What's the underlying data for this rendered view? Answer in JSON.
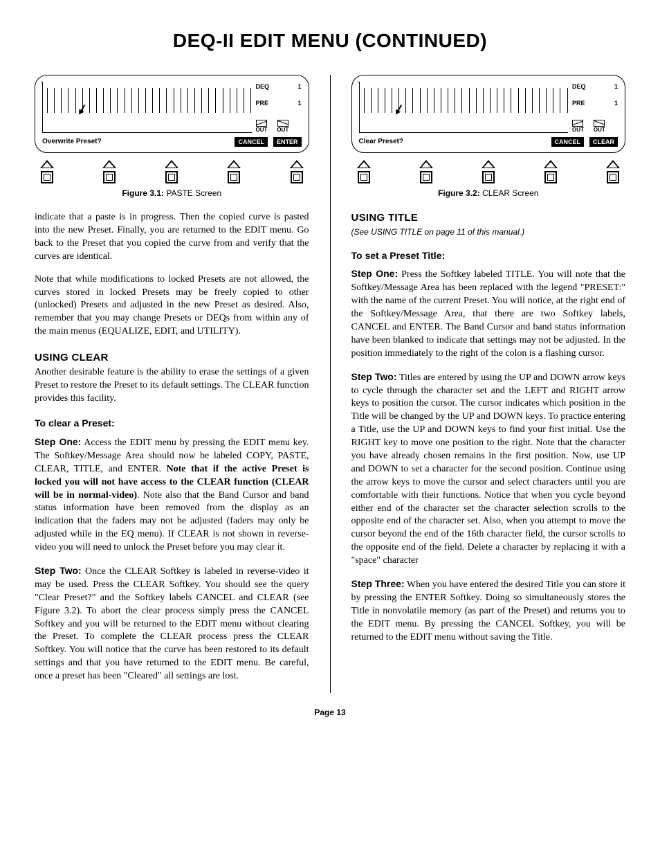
{
  "pageTitle": "DEQ-II EDIT MENU (CONTINUED)",
  "pageNumber": "Page 13",
  "figures": {
    "f1": {
      "question": "Overwrite Preset?",
      "btn1": "CANCEL",
      "btn2": "ENTER",
      "deq": "DEQ",
      "deqv": "1",
      "pre": "PRE",
      "prev": "1",
      "out": "OUT",
      "captionBold": "Figure 3.1:",
      "captionRest": " PASTE Screen"
    },
    "f2": {
      "question": "Clear Preset?",
      "btn1": "CANCEL",
      "btn2": "CLEAR",
      "deq": "DEQ",
      "deqv": "1",
      "pre": "PRE",
      "prev": "1",
      "out": "OUT",
      "captionBold": "Figure 3.2:",
      "captionRest": " CLEAR Screen"
    }
  },
  "left": {
    "p1": "indicate that a paste is in progress. Then the copied curve is pasted into the new Preset. Finally, you are returned to the EDIT menu. Go back to the Preset that you copied the curve from and verify that the curves are identical.",
    "p2": "Note that while modifications to locked Presets are not allowed, the curves stored in locked Presets may be freely copied to other (unlocked) Presets and adjusted in the new Preset as desired. Also, remember that you may change Presets or DEQs from within any of the main menus (EQUALIZE, EDIT, and UTILITY).",
    "h_clear": "USING CLEAR",
    "p3": "Another desirable feature is the ability to erase the settings of a given Preset to restore the Preset to its default settings. The CLEAR function provides this facility.",
    "h_toclear": "To clear a Preset:",
    "s1_label": "Step One:",
    "s1_a": "  Access the EDIT menu by pressing the EDIT menu key.  The Softkey/Message Area should now be labeled COPY, PASTE, CLEAR, TITLE, and ENTER.  ",
    "s1_bold": "Note that if the active Preset is locked  you will not have access to the CLEAR function (CLEAR will be in normal-video)",
    "s1_b": ".  Note also that the Band Cursor and band status information have been removed from the display as an indication that the faders may not be adjusted (faders may only be adjusted while in the EQ menu).  If CLEAR is not shown in reverse-video you will need to unlock the Preset before you may clear it.",
    "s2_label": "Step Two:",
    "s2": " Once the CLEAR Softkey is labeled in reverse-video it may be used.  Press the CLEAR Softkey.  You should see the query \"Clear Preset?\" and the Softkey labels CANCEL and CLEAR (see Figure 3.2).  To abort the clear process simply press the CANCEL Softkey and you will be returned to the EDIT menu without clearing the Preset.  To complete the CLEAR process press the CLEAR Softkey.  You will notice that the curve has been restored to its default settings and that you have returned to the EDIT menu. Be careful, once a preset has been \"Cleared\" all settings are lost."
  },
  "right": {
    "h_title": "USING TITLE",
    "note": "(See USING TITLE on page 11 of this manual.)",
    "h_set": "To set a Preset Title:",
    "s1_label": "Step One:",
    "s1": " Press the Softkey labeled TITLE.  You will note that the Softkey/Message Area has been replaced with the legend \"PRESET:\" with the name of the current Preset. You will  notice, at the right end of the Softkey/Message Area, that there are two Softkey labels, CANCEL and ENTER. The Band Cursor and band status information have been blanked to indicate that settings may not be adjusted.  In the position immediately to the right of the colon is a flashing cursor.",
    "s2_label": "Step Two:",
    "s2": " Titles are entered by using the UP and DOWN arrow keys to cycle through the character set and the LEFT and RIGHT arrow keys to position the cursor.  The cursor indicates which position in the Title will be changed by the UP and DOWN keys.  To practice entering a Title, use the UP and DOWN keys to find your first initial.  Use the RIGHT key to move one position to the right.  Note that the character you have already chosen remains in the first position.  Now, use UP and DOWN to set a character for the second position.  Continue using the arrow keys to move the cursor and select characters until you are comfortable with their functions.  Notice that when you cycle beyond either end of the character set the character selection scrolls to the opposite end of the character set.  Also, when you attempt to move the cursor beyond the end of the 16th character field, the cursor scrolls to the opposite end of the field. Delete a character by replacing it with a \"space\" character",
    "s3_label": "Step Three:",
    "s3": " When you have entered the desired Title you can store it by pressing the ENTER Softkey.  Doing so simultaneously stores the Title in nonvolatile memory (as part of the Preset) and returns you to the EDIT menu.  By pressing the CANCEL Softkey,  you will be returned to the EDIT menu without saving the Title."
  }
}
